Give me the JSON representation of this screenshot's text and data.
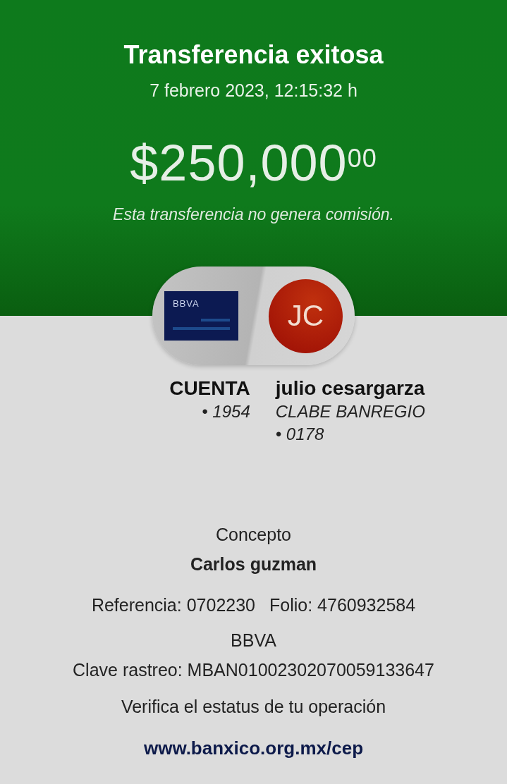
{
  "header": {
    "title": "Transferencia exitosa",
    "datetime": "7 febrero 2023, 12:15:32 h",
    "amount": "$250,000$^{00}$",
    "note": "Esta transferencia no genera comisión."
  },
  "origin": {
    "card_brand": "BBVA",
    "label": "CUENTA",
    "detail": "• 1954"
  },
  "destination": {
    "initials": "JC",
    "name": "julio cesargarza",
    "detail": "CLABE BANREGIO",
    "account": "• 0178"
  },
  "concept": {
    "label": "Concepto",
    "value": "Carlos guzman"
  },
  "reference": "Referencia: 0702230",
  "folio": "Folio: 4760932584",
  "bank": "BBVA",
  "tracking": "Clave rastreo: MBAN01002302070059133647",
  "verify": "Verifica el estatus de tu operación",
  "link": "www.banxico.org.mx/cep"
}
